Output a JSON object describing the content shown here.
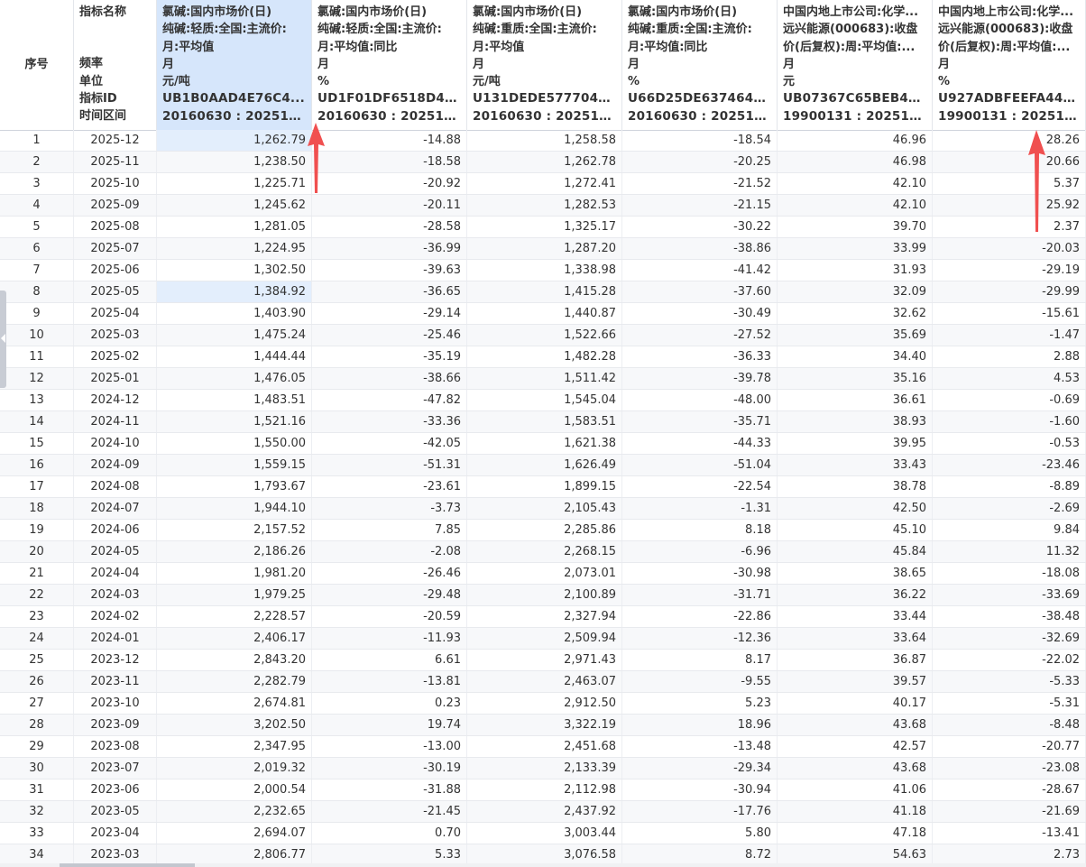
{
  "header": {
    "index_label": "序号",
    "meta_labels": [
      "指标名称",
      "频率",
      "单位",
      "指标ID",
      "时间区间"
    ],
    "columns": [
      {
        "lines": [
          "氯碱:国内市场价(日)",
          "纯碱:轻质:全国:主流价:",
          "月:平均值",
          "月",
          "元/吨",
          "UB1B0AAD4E76C4...",
          "20160630 : 20251231"
        ]
      },
      {
        "lines": [
          "氯碱:国内市场价(日)",
          "纯碱:轻质:全国:主流价:",
          "月:平均值:同比",
          "月",
          "%",
          "UD1F01DF6518D49...",
          "20160630 : 20251231"
        ]
      },
      {
        "lines": [
          "氯碱:国内市场价(日)",
          "纯碱:重质:全国:主流价:",
          "月:平均值",
          "月",
          "元/吨",
          "U131DEDE577704C...",
          "20160630 : 20251231"
        ]
      },
      {
        "lines": [
          "氯碱:国内市场价(日)",
          "纯碱:重质:全国:主流价:",
          "月:平均值:同比",
          "月",
          "%",
          "U66D25DE6374649...",
          "20160630 : 20251231"
        ]
      },
      {
        "lines": [
          "中国内地上市公司:化学...",
          "远兴能源(000683):收盘",
          "价(后复权):周:平均值:...",
          "月",
          "元",
          "UB07367C65BEB44...",
          "19900131 : 20251231"
        ]
      },
      {
        "lines": [
          "中国内地上市公司:化学...",
          "远兴能源(000683):收盘",
          "价(后复权):周:平均值:...",
          "月",
          "%",
          "U927ADBFEEFA446...",
          "19900131 : 20251231"
        ]
      }
    ]
  },
  "rows": [
    [
      "1",
      "2025-12",
      "1,262.79",
      "-14.88",
      "1,258.58",
      "-18.54",
      "46.96",
      "28.26"
    ],
    [
      "2",
      "2025-11",
      "1,238.50",
      "-18.58",
      "1,262.78",
      "-20.25",
      "46.98",
      "20.66"
    ],
    [
      "3",
      "2025-10",
      "1,225.71",
      "-20.92",
      "1,272.41",
      "-21.52",
      "42.10",
      "5.37"
    ],
    [
      "4",
      "2025-09",
      "1,245.62",
      "-20.11",
      "1,282.53",
      "-21.15",
      "42.10",
      "25.92"
    ],
    [
      "5",
      "2025-08",
      "1,281.05",
      "-28.58",
      "1,325.17",
      "-30.22",
      "39.70",
      "2.37"
    ],
    [
      "6",
      "2025-07",
      "1,224.95",
      "-36.99",
      "1,287.20",
      "-38.86",
      "33.99",
      "-20.03"
    ],
    [
      "7",
      "2025-06",
      "1,302.50",
      "-39.63",
      "1,338.98",
      "-41.42",
      "31.93",
      "-29.19"
    ],
    [
      "8",
      "2025-05",
      "1,384.92",
      "-36.65",
      "1,415.28",
      "-37.60",
      "32.09",
      "-29.99"
    ],
    [
      "9",
      "2025-04",
      "1,403.90",
      "-29.14",
      "1,440.87",
      "-30.49",
      "32.62",
      "-15.61"
    ],
    [
      "10",
      "2025-03",
      "1,475.24",
      "-25.46",
      "1,522.66",
      "-27.52",
      "35.69",
      "-1.47"
    ],
    [
      "11",
      "2025-02",
      "1,444.44",
      "-35.19",
      "1,482.28",
      "-36.33",
      "34.40",
      "2.88"
    ],
    [
      "12",
      "2025-01",
      "1,476.05",
      "-38.66",
      "1,511.42",
      "-39.78",
      "35.16",
      "4.53"
    ],
    [
      "13",
      "2024-12",
      "1,483.51",
      "-47.82",
      "1,545.04",
      "-48.00",
      "36.61",
      "-0.69"
    ],
    [
      "14",
      "2024-11",
      "1,521.16",
      "-33.36",
      "1,583.51",
      "-35.71",
      "38.93",
      "-1.60"
    ],
    [
      "15",
      "2024-10",
      "1,550.00",
      "-42.05",
      "1,621.38",
      "-44.33",
      "39.95",
      "-0.53"
    ],
    [
      "16",
      "2024-09",
      "1,559.15",
      "-51.31",
      "1,626.49",
      "-51.04",
      "33.43",
      "-23.46"
    ],
    [
      "17",
      "2024-08",
      "1,793.67",
      "-23.61",
      "1,899.15",
      "-22.54",
      "38.78",
      "-8.89"
    ],
    [
      "18",
      "2024-07",
      "1,944.10",
      "-3.73",
      "2,105.43",
      "-1.31",
      "42.50",
      "-2.69"
    ],
    [
      "19",
      "2024-06",
      "2,157.52",
      "7.85",
      "2,285.86",
      "8.18",
      "45.10",
      "9.84"
    ],
    [
      "20",
      "2024-05",
      "2,186.26",
      "-2.08",
      "2,268.15",
      "-6.96",
      "45.84",
      "11.32"
    ],
    [
      "21",
      "2024-04",
      "1,981.20",
      "-26.46",
      "2,073.01",
      "-30.98",
      "38.65",
      "-18.08"
    ],
    [
      "22",
      "2024-03",
      "1,979.25",
      "-29.48",
      "2,100.89",
      "-31.71",
      "36.22",
      "-33.69"
    ],
    [
      "23",
      "2024-02",
      "2,228.57",
      "-20.59",
      "2,327.94",
      "-22.86",
      "33.44",
      "-38.48"
    ],
    [
      "24",
      "2024-01",
      "2,406.17",
      "-11.93",
      "2,509.94",
      "-12.36",
      "33.64",
      "-32.69"
    ],
    [
      "25",
      "2023-12",
      "2,843.20",
      "6.61",
      "2,971.43",
      "8.17",
      "36.87",
      "-22.02"
    ],
    [
      "26",
      "2023-11",
      "2,282.79",
      "-13.81",
      "2,463.07",
      "-9.55",
      "39.57",
      "-5.33"
    ],
    [
      "27",
      "2023-10",
      "2,674.81",
      "0.23",
      "2,912.50",
      "5.23",
      "40.17",
      "-5.31"
    ],
    [
      "28",
      "2023-09",
      "3,202.50",
      "19.74",
      "3,322.19",
      "18.96",
      "43.68",
      "-8.48"
    ],
    [
      "29",
      "2023-08",
      "2,347.95",
      "-13.00",
      "2,451.68",
      "-13.48",
      "42.57",
      "-20.77"
    ],
    [
      "30",
      "2023-07",
      "2,019.32",
      "-30.19",
      "2,133.39",
      "-29.34",
      "43.68",
      "-23.08"
    ],
    [
      "31",
      "2023-06",
      "2,000.54",
      "-31.88",
      "2,112.98",
      "-30.94",
      "41.06",
      "-28.67"
    ],
    [
      "32",
      "2023-05",
      "2,232.65",
      "-21.45",
      "2,437.92",
      "-17.76",
      "41.18",
      "-21.69"
    ],
    [
      "33",
      "2023-04",
      "2,694.07",
      "0.70",
      "3,003.44",
      "5.80",
      "47.18",
      "-13.41"
    ],
    [
      "34",
      "2023-03",
      "2,806.77",
      "5.33",
      "3,076.58",
      "8.72",
      "54.63",
      "2.73"
    ]
  ],
  "colors": {
    "highlight": "#d6e6fb",
    "selected_cell": "#e3eefc",
    "annotation_arrow": "#f05050"
  },
  "icons": {
    "arrow": "annotation-arrow-icon",
    "collapse": "collapse-left-icon"
  }
}
